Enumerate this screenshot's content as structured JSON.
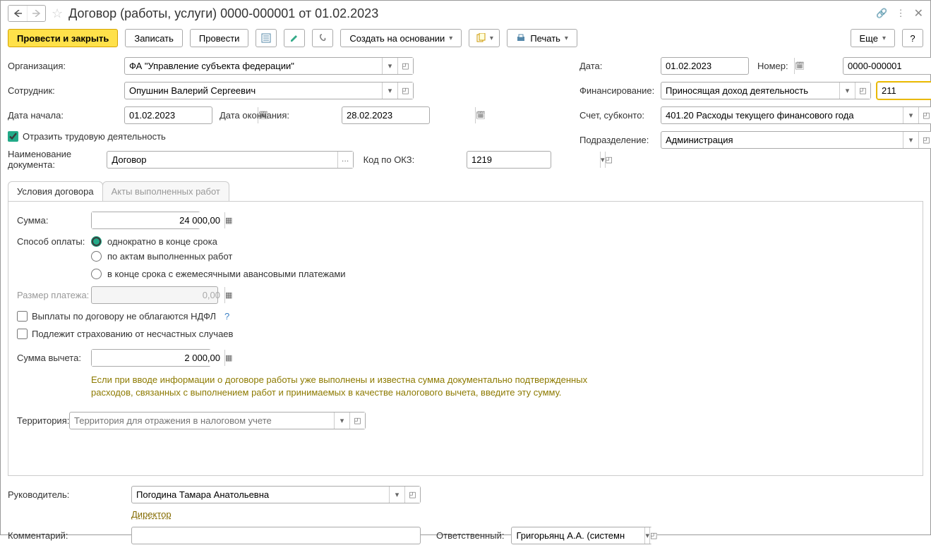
{
  "header": {
    "title": "Договор (работы, услуги) 0000-000001 от 01.02.2023"
  },
  "toolbar": {
    "post_close": "Провести и закрыть",
    "save": "Записать",
    "post": "Провести",
    "create_based": "Создать на основании",
    "print": "Печать",
    "more": "Еще"
  },
  "form": {
    "org_label": "Организация:",
    "org_value": "ФА \"Управление субъекта федерации\"",
    "emp_label": "Сотрудник:",
    "emp_value": "Опушнин Валерий Сергеевич",
    "start_label": "Дата начала:",
    "start_value": "01.02.2023",
    "end_label": "Дата окончания:",
    "end_value": "28.02.2023",
    "reflect_labor": "Отразить трудовую деятельность",
    "docname_label": "Наименование документа:",
    "docname_value": "Договор",
    "okz_label": "Код по ОКЗ:",
    "okz_value": "1219",
    "date_label": "Дата:",
    "date_value": "01.02.2023",
    "num_label": "Номер:",
    "num_value": "0000-000001",
    "fin_label": "Финансирование:",
    "fin_value": "Приносящая доход деятельность",
    "kosgu_value": "211",
    "acct_label": "Счет, субконто:",
    "acct_value": "401.20 Расходы текущего финансового года",
    "dept_label": "Подразделение:",
    "dept_value": "Администрация"
  },
  "tabs": {
    "t1": "Условия договора",
    "t2": "Акты выполненных работ"
  },
  "pane": {
    "sum_label": "Сумма:",
    "sum_value": "24 000,00",
    "payway_label": "Способ оплаты:",
    "payway_1": "однократно в конце срока",
    "payway_2": "по актам выполненных работ",
    "payway_3": "в конце срока с ежемесячными авансовыми платежами",
    "paysize_label": "Размер платежа:",
    "paysize_value": "0,00",
    "no_ndfl": "Выплаты по договору не облагаются НДФЛ",
    "insurance": "Подлежит страхованию от несчастных случаев",
    "deduct_label": "Сумма вычета:",
    "deduct_value": "2 000,00",
    "hint": "Если при вводе информации о договоре работы уже выполнены и известна сумма документально подтвержденных расходов, связанных с выполнением работ и принимаемых в качестве налогового вычета, введите эту сумму.",
    "terr_label": "Территория:",
    "terr_placeholder": "Территория для отражения в налоговом учете"
  },
  "footer": {
    "lead_label": "Руководитель:",
    "lead_value": "Погодина Тамара Анатольевна",
    "lead_post": "Директор",
    "comment_label": "Комментарий:",
    "resp_label": "Ответственный:",
    "resp_value": "Григорьянц А.А. (системн"
  }
}
